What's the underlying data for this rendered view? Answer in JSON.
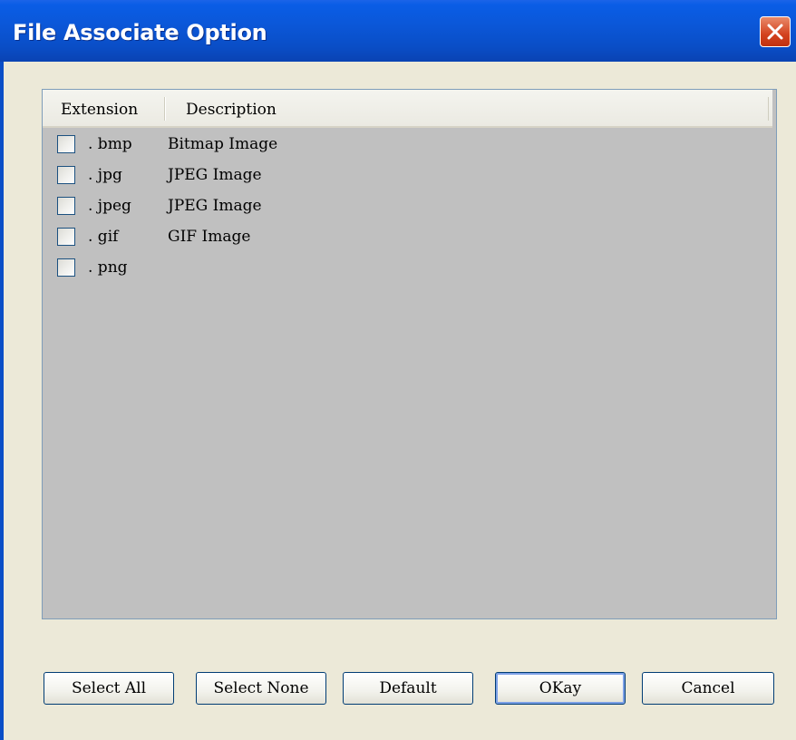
{
  "window": {
    "title": "File Associate Option"
  },
  "list": {
    "columns": [
      "Extension",
      "Description"
    ],
    "rows": [
      {
        "extension": ". bmp",
        "description": "Bitmap Image",
        "checked": false
      },
      {
        "extension": ". jpg",
        "description": "JPEG Image",
        "checked": false
      },
      {
        "extension": ". jpeg",
        "description": "JPEG Image",
        "checked": false
      },
      {
        "extension": ". gif",
        "description": "GIF Image",
        "checked": false
      },
      {
        "extension": ". png",
        "description": "",
        "checked": false
      }
    ]
  },
  "buttons": {
    "select_all": "Select All",
    "select_none": "Select None",
    "default": "Default",
    "okay": "OKay",
    "cancel": "Cancel"
  },
  "colors": {
    "titlebar": "#0a4ec7",
    "list_background": "#c0c0c0",
    "dialog_background": "#ece9d8",
    "close_button": "#d3421e"
  }
}
